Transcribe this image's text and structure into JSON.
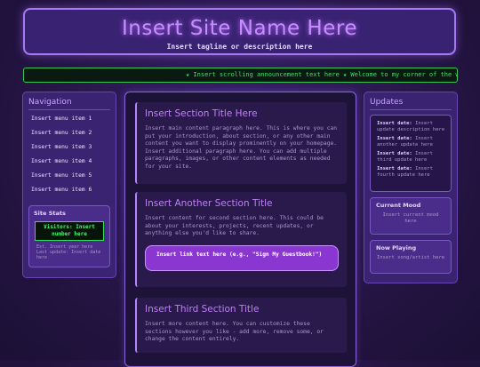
{
  "header": {
    "site_title": "Insert Site Name Here",
    "tagline": "Insert tagline or description here"
  },
  "marquee": {
    "text": "★ Insert scrolling announcement text here ★ Welcome to my corner of the web"
  },
  "nav": {
    "title": "Navigation",
    "items": [
      "Insert menu item 1",
      "Insert menu item 2",
      "Insert menu item 3",
      "Insert menu item 4",
      "Insert menu item 5",
      "Insert menu item 6"
    ]
  },
  "stats": {
    "title": "Site Stats",
    "visitors": "Visitors: Insert number here",
    "note": "Est. Insert year here\nLast update: Insert date here"
  },
  "sections": [
    {
      "title": "Insert Section Title Here",
      "body": "Insert main content paragraph here. This is where you can put your introduction, about section, or any other main content you want to display prominently on your homepage.\nInsert additional paragraph here. You can add multiple paragraphs, images, or other content elements as needed for your site."
    },
    {
      "title": "Insert Another Section Title",
      "body": "Insert content for second section here. This could be about your interests, projects, recent updates, or anything else you'd like to share.",
      "link_label": "Insert link text here (e.g., \"Sign My Guestbook!\")"
    },
    {
      "title": "Insert Third Section Title",
      "body": "Insert more content here. You can customize these sections however you like - add more, remove some, or change the content entirely."
    }
  ],
  "updates": {
    "title": "Updates",
    "items": [
      {
        "date": "Insert date:",
        "text": "Insert update description here"
      },
      {
        "date": "Insert date:",
        "text": "Insert another update here"
      },
      {
        "date": "Insert date:",
        "text": "Insert third update here"
      },
      {
        "date": "Insert date:",
        "text": "Insert fourth update here"
      }
    ]
  },
  "mood": {
    "title": "Current Mood",
    "text": "Insert current mood here"
  },
  "now_playing": {
    "title": "Now Playing",
    "text": "Insert song/artist here"
  }
}
